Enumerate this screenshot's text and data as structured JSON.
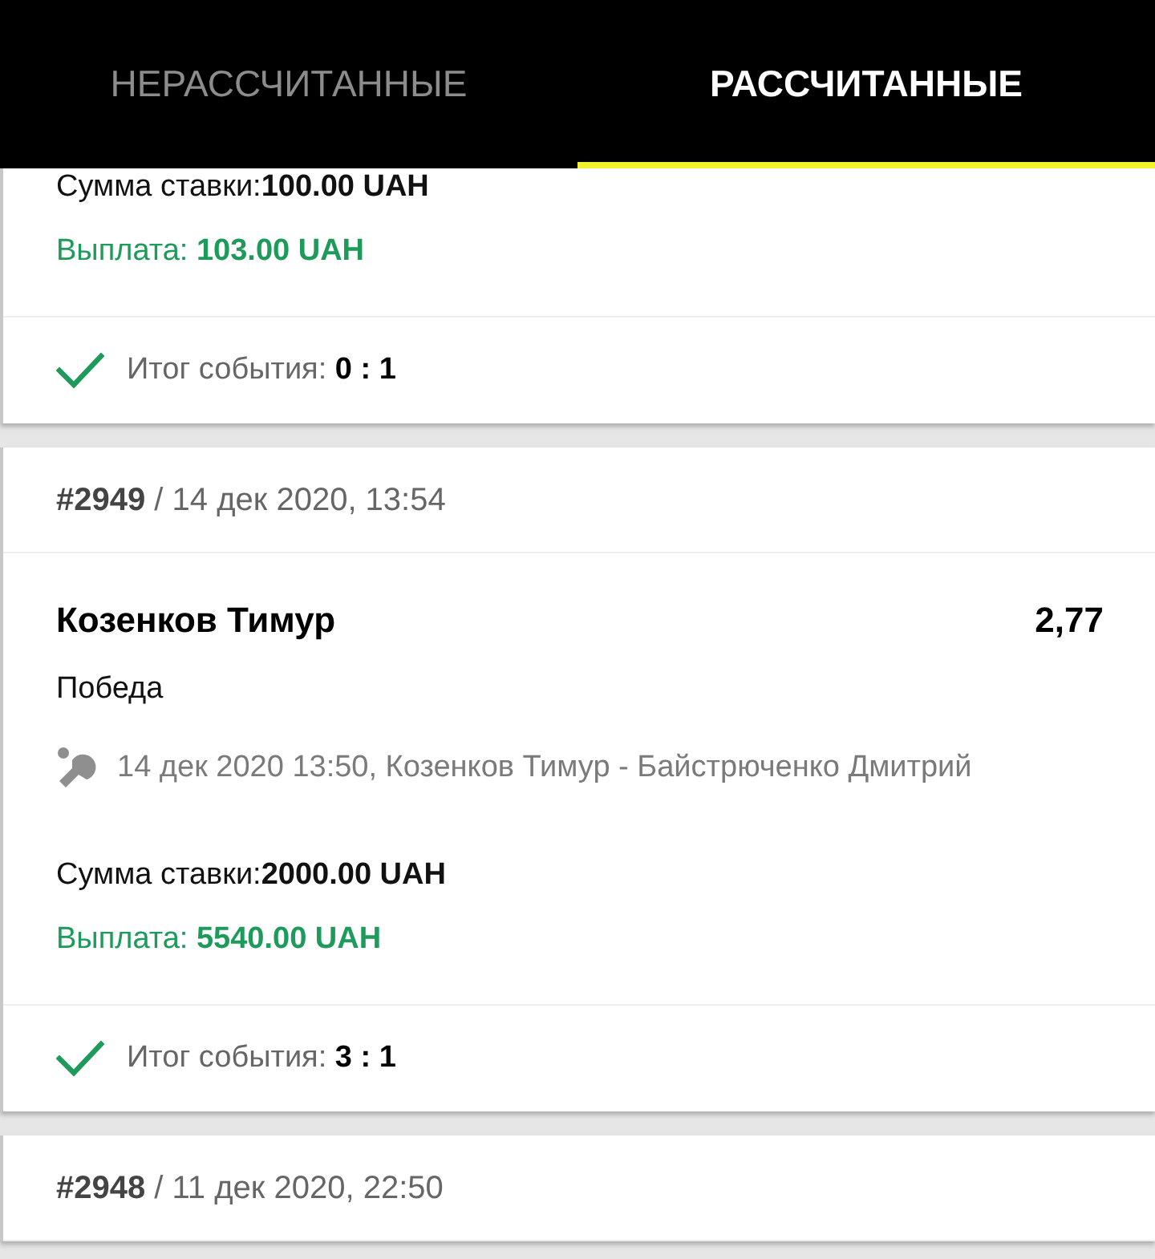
{
  "tabs": [
    {
      "label": "НЕРАССЧИТАННЫЕ",
      "selected": false
    },
    {
      "label": "РАССЧИТАННЫЕ",
      "selected": true
    }
  ],
  "bets": [
    {
      "stake": "Сумма ставки:**100.00 UAH**",
      "payout": "Выплата: **103.00 UAH**",
      "result": "Итог события: **0 : 1**"
    },
    {
      "header": "**#2949** / 14 дек 2020, 13:54",
      "selection": "Козенков Тимур",
      "odds": "2,77",
      "market": "Победа",
      "event": "14 дек 2020 13:50, Козенков Тимур - Байстрюченко Дмитрий",
      "stake": "Сумма ставки:**2000.00 UAH**",
      "payout": "Выплата: **5540.00 UAH**",
      "result": "Итог события: **3 : 1**"
    },
    {
      "header": "**#2948** / 11 дек 2020, 22:50"
    }
  ]
}
